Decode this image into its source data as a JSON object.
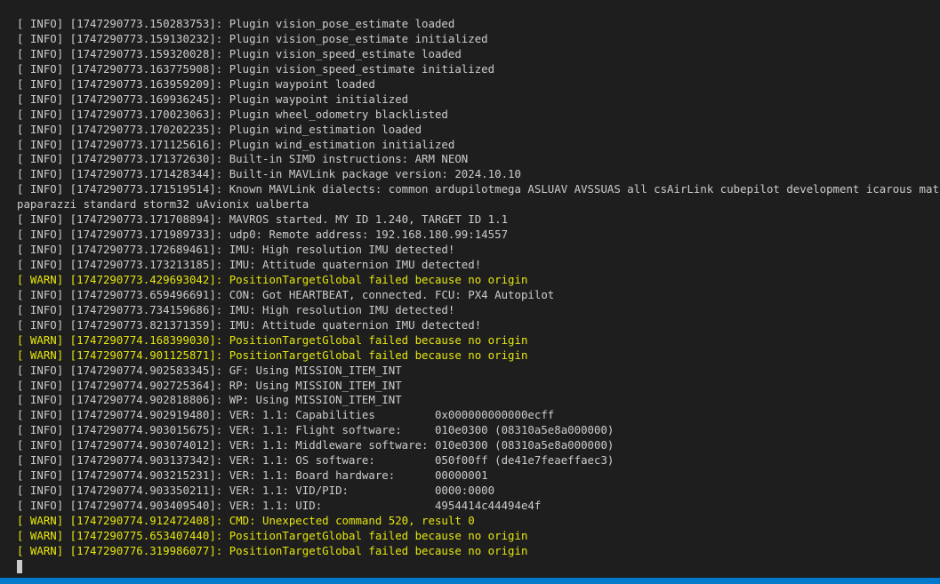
{
  "colors": {
    "background": "#1e1e1e",
    "info_text": "#cccccc",
    "warn_text": "#e5e510",
    "status_bar": "#007acc"
  },
  "terminal": {
    "lines": [
      {
        "level": "info",
        "text": "[ INFO] [1747290773.150283753]: Plugin vision_pose_estimate loaded"
      },
      {
        "level": "info",
        "text": "[ INFO] [1747290773.159130232]: Plugin vision_pose_estimate initialized"
      },
      {
        "level": "info",
        "text": "[ INFO] [1747290773.159320028]: Plugin vision_speed_estimate loaded"
      },
      {
        "level": "info",
        "text": "[ INFO] [1747290773.163775908]: Plugin vision_speed_estimate initialized"
      },
      {
        "level": "info",
        "text": "[ INFO] [1747290773.163959209]: Plugin waypoint loaded"
      },
      {
        "level": "info",
        "text": "[ INFO] [1747290773.169936245]: Plugin waypoint initialized"
      },
      {
        "level": "info",
        "text": "[ INFO] [1747290773.170023063]: Plugin wheel_odometry blacklisted"
      },
      {
        "level": "info",
        "text": "[ INFO] [1747290773.170202235]: Plugin wind_estimation loaded"
      },
      {
        "level": "info",
        "text": "[ INFO] [1747290773.171125616]: Plugin wind_estimation initialized"
      },
      {
        "level": "info",
        "text": "[ INFO] [1747290773.171372630]: Built-in SIMD instructions: ARM NEON"
      },
      {
        "level": "info",
        "text": "[ INFO] [1747290773.171428344]: Built-in MAVLink package version: 2024.10.10"
      },
      {
        "level": "info",
        "text": "[ INFO] [1747290773.171519514]: Known MAVLink dialects: common ardupilotmega ASLUAV AVSSUAS all csAirLink cubepilot development icarous matrixpilot"
      },
      {
        "level": "info",
        "text": "paparazzi standard storm32 uAvionix ualberta"
      },
      {
        "level": "info",
        "text": "[ INFO] [1747290773.171708894]: MAVROS started. MY ID 1.240, TARGET ID 1.1"
      },
      {
        "level": "info",
        "text": "[ INFO] [1747290773.171989733]: udp0: Remote address: 192.168.180.99:14557"
      },
      {
        "level": "info",
        "text": "[ INFO] [1747290773.172689461]: IMU: High resolution IMU detected!"
      },
      {
        "level": "info",
        "text": "[ INFO] [1747290773.173213185]: IMU: Attitude quaternion IMU detected!"
      },
      {
        "level": "warn",
        "text": "[ WARN] [1747290773.429693042]: PositionTargetGlobal failed because no origin"
      },
      {
        "level": "info",
        "text": "[ INFO] [1747290773.659496691]: CON: Got HEARTBEAT, connected. FCU: PX4 Autopilot"
      },
      {
        "level": "info",
        "text": "[ INFO] [1747290773.734159686]: IMU: High resolution IMU detected!"
      },
      {
        "level": "info",
        "text": "[ INFO] [1747290773.821371359]: IMU: Attitude quaternion IMU detected!"
      },
      {
        "level": "warn",
        "text": "[ WARN] [1747290774.168399030]: PositionTargetGlobal failed because no origin"
      },
      {
        "level": "warn",
        "text": "[ WARN] [1747290774.901125871]: PositionTargetGlobal failed because no origin"
      },
      {
        "level": "info",
        "text": "[ INFO] [1747290774.902583345]: GF: Using MISSION_ITEM_INT"
      },
      {
        "level": "info",
        "text": "[ INFO] [1747290774.902725364]: RP: Using MISSION_ITEM_INT"
      },
      {
        "level": "info",
        "text": "[ INFO] [1747290774.902818806]: WP: Using MISSION_ITEM_INT"
      },
      {
        "level": "info",
        "text": "[ INFO] [1747290774.902919480]: VER: 1.1: Capabilities         0x000000000000ecff"
      },
      {
        "level": "info",
        "text": "[ INFO] [1747290774.903015675]: VER: 1.1: Flight software:     010e0300 (08310a5e8a000000)"
      },
      {
        "level": "info",
        "text": "[ INFO] [1747290774.903074012]: VER: 1.1: Middleware software: 010e0300 (08310a5e8a000000)"
      },
      {
        "level": "info",
        "text": "[ INFO] [1747290774.903137342]: VER: 1.1: OS software:         050f00ff (de41e7feaeffaec3)"
      },
      {
        "level": "info",
        "text": "[ INFO] [1747290774.903215231]: VER: 1.1: Board hardware:      00000001"
      },
      {
        "level": "info",
        "text": "[ INFO] [1747290774.903350211]: VER: 1.1: VID/PID:             0000:0000"
      },
      {
        "level": "info",
        "text": "[ INFO] [1747290774.903409540]: VER: 1.1: UID:                 4954414c44494e4f"
      },
      {
        "level": "warn",
        "text": "[ WARN] [1747290774.912472408]: CMD: Unexpected command 520, result 0"
      },
      {
        "level": "warn",
        "text": "[ WARN] [1747290775.653407440]: PositionTargetGlobal failed because no origin"
      },
      {
        "level": "warn",
        "text": "[ WARN] [1747290776.319986077]: PositionTargetGlobal failed because no origin"
      }
    ]
  }
}
